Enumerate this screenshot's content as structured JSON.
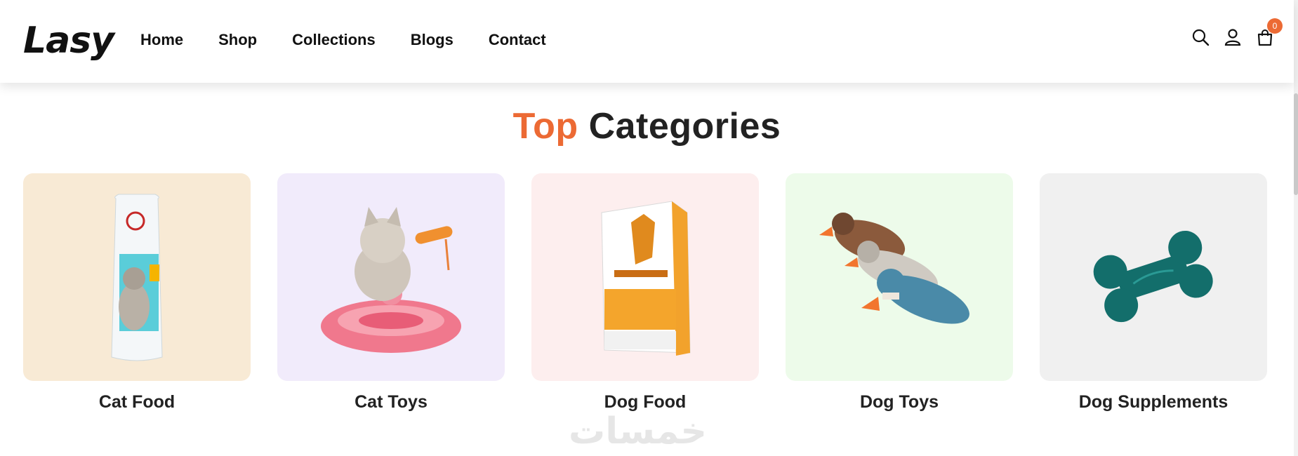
{
  "header": {
    "logo": "Lasy",
    "nav": [
      "Home",
      "Shop",
      "Collections",
      "Blogs",
      "Contact"
    ],
    "cart_count": "0"
  },
  "section": {
    "title_accent": "Top",
    "title_rest": "Categories",
    "accent_color": "#ec6a34"
  },
  "categories": [
    {
      "label": "Cat Food",
      "bg": "#f8ead5",
      "icon": "cat-food-bag-icon"
    },
    {
      "label": "Cat Toys",
      "bg": "#f1ebfb",
      "icon": "cat-toy-icon"
    },
    {
      "label": "Dog Food",
      "bg": "#fdeeee",
      "icon": "dog-food-bag-icon"
    },
    {
      "label": "Dog Toys",
      "bg": "#edfbea",
      "icon": "plush-duck-icon"
    },
    {
      "label": "Dog Supplements",
      "bg": "#f0f0f0",
      "icon": "bone-plush-icon"
    }
  ],
  "watermark": "خمسات"
}
